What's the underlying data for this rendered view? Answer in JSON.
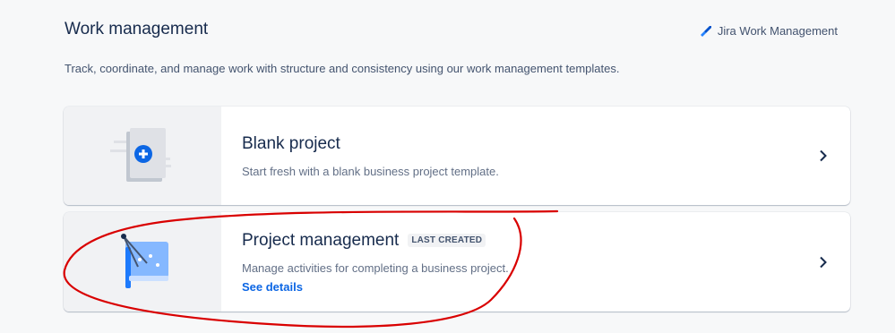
{
  "header": {
    "title": "Work management",
    "product_label": "Jira Work Management",
    "product_icon": "jira-logo-icon",
    "description": "Track, coordinate, and manage work with structure and consistency using our work management templates."
  },
  "templates": [
    {
      "title": "Blank project",
      "description": "Start fresh with a blank business project template.",
      "icon": "blank-project-illustration"
    },
    {
      "title": "Project management",
      "badge": "LAST CREATED",
      "description": "Manage activities for completing a business project.",
      "link": "See details",
      "icon": "project-management-illustration"
    }
  ],
  "colors": {
    "background": "#f7f8f9",
    "link": "#0c66e4",
    "accent_blue": "#1d7afc",
    "annotation_red": "#d90000"
  }
}
